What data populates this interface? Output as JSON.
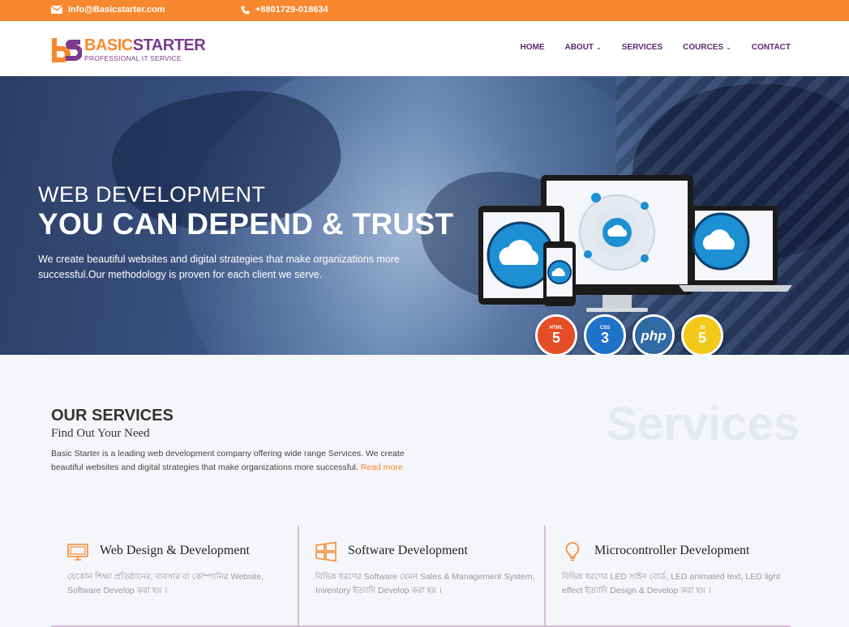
{
  "topbar": {
    "email": "Info@Basicstarter.com",
    "phone": "+8801729-018634"
  },
  "logo": {
    "mark": "bS",
    "title_part1": "BASIC",
    "title_part2": "STARTER",
    "subtitle": "PROFESSIONAL IT SERVICE"
  },
  "nav": {
    "items": [
      {
        "label": "HOME",
        "has_dropdown": false
      },
      {
        "label": "ABOUT",
        "has_dropdown": true
      },
      {
        "label": "SERVICES",
        "has_dropdown": false
      },
      {
        "label": "COURCES",
        "has_dropdown": true
      },
      {
        "label": "CONTACT",
        "has_dropdown": false
      }
    ]
  },
  "hero": {
    "line1": "WEB DEVELOPMENT",
    "line2": "YOU CAN DEPEND & TRUST",
    "description": "We create beautiful websites and digital strategies that make organizations more successful.Our methodology is proven for each client we serve.",
    "badges": [
      {
        "small": "HTML",
        "big": "5"
      },
      {
        "small": "CSS",
        "big": "3"
      },
      {
        "small": "",
        "big": "php"
      },
      {
        "small": "JS",
        "big": "5"
      }
    ]
  },
  "services": {
    "title": "OUR SERVICES",
    "subtitle": "Find Out Your Need",
    "description": "Basic Starter is a leading web development company offering wide range Services. We create beautiful websites and digital strategies that make organizations more successful.",
    "read_more": "Read more",
    "watermark": "Services",
    "cards": [
      {
        "title": "Web Design & Development",
        "text": "যেকোন শিক্ষা প্রতিষ্ঠানের, ব্যবসার বা কোম্পানির Website, Software Develop করা হয় ।",
        "icon": "monitor-icon"
      },
      {
        "title": "Software Development",
        "text": "বিভিন্ন ধরণের Software যেমন Sales & Management System, Inventory ইত্যাদি Develop করা হয় ।",
        "icon": "windows-icon"
      },
      {
        "title": "Microcontroller Development",
        "text": "বিভিন্ন ধরণের LED সাইন বোর্ড, LED animated text, LED light effect ইত্যাদি Design & Develop করা হয় ।",
        "icon": "lightbulb-icon"
      }
    ]
  },
  "colors": {
    "accent": "#f7882f",
    "brand_purple": "#7a3a8f",
    "nav_text": "#5b2a6e",
    "divider": "#d8b9dc"
  }
}
